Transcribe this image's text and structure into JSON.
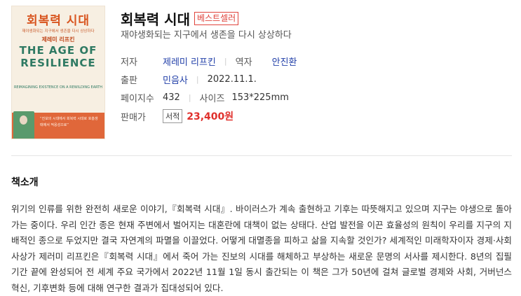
{
  "book": {
    "cover": {
      "title_ko": "회복력 시대",
      "subtitle_ko": "재야생화되는 지구에서 생존을 다시 상상하다",
      "author_ko": "제레미 리프킨",
      "title_en": "THE AGE OF RESILIENCE",
      "subtitle_en": "REIMAGINING EXISTENCE ON A REWILDING EARTH",
      "band_text": "“진보의 시대에서 회복력 시대로 호흡생태에서 적응성으로”"
    },
    "title": "회복력 시대",
    "badge": "베스트셀러",
    "subtitle": "재야생화되는 지구에서 생존을 다시 상상하다",
    "author_label": "저자",
    "author": "제레미 리프킨",
    "translator_label": "역자",
    "translator": "안진환",
    "publisher_label": "출판",
    "publisher": "민음사",
    "date": "2022.11.1.",
    "pages_label": "페이지수",
    "pages": "432",
    "size_label": "사이즈",
    "size": "153*225mm",
    "price_label": "판매가",
    "store_tag": "서적",
    "price": "23,400원"
  },
  "intro": {
    "heading": "책소개",
    "body": "위기의 인류를 위한 완전히 새로운 이야기,『회복력 시대』. 바이러스가 계속 출현하고 기후는 따뜻해지고 있으며 지구는 야생으로 돌아가는 중이다. 우리 인간 종은 현재 주변에서 벌어지는 대혼란에 대책이 없는 상태다. 산업 발전을 이끈 효율성의 원칙이 우리를 지구의 지배적인 종으로 두었지만 결국 자연계의 파멸을 이끌었다. 어떻게 대멸종을 피하고 삶을 지속할 것인가? 세계적인 미래학자이자 경제·사회사상가 제러미 리프킨은『회복력 시대』에서 죽어 가는 진보의 시대를 해체하고 부상하는 새로운 문명의 서사를 제시한다. 8년의 집필 기간 끝에 완성되어 전 세계 주요 국가에서 2022년 11월 1일 동시 출간되는 이 책은 그가 50년에 걸쳐 글로벌 경제와 사회, 거버넌스 혁신, 기후변화 등에 대해 연구한 결과가 집대성되어 있다."
  }
}
